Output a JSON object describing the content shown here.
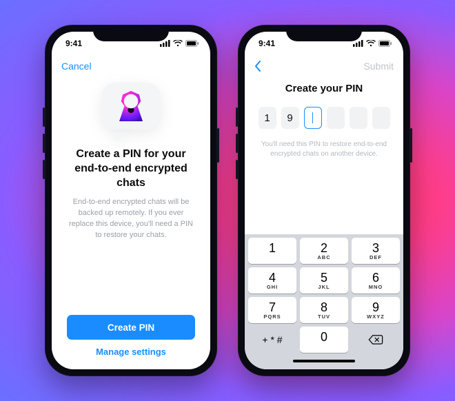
{
  "status": {
    "time": "9:41"
  },
  "screen1": {
    "nav": {
      "cancel": "Cancel"
    },
    "title": "Create a PIN for your end-to-end encrypted chats",
    "description": "End-to-end encrypted chats will be backed up remotely. If you ever replace this device, you'll need a PIN to restore your chats.",
    "primary": "Create PIN",
    "secondary": "Manage settings"
  },
  "screen2": {
    "nav": {
      "submit": "Submit"
    },
    "title": "Create your PIN",
    "pin": [
      "1",
      "9",
      "",
      "",
      "",
      ""
    ],
    "active_index": 2,
    "hint": "You'll need this PIN to restore end-to-end encrypted chats on another device.",
    "keypad": {
      "keys": [
        {
          "num": "1",
          "letters": ""
        },
        {
          "num": "2",
          "letters": "ABC"
        },
        {
          "num": "3",
          "letters": "DEF"
        },
        {
          "num": "4",
          "letters": "GHI"
        },
        {
          "num": "5",
          "letters": "JKL"
        },
        {
          "num": "6",
          "letters": "MNO"
        },
        {
          "num": "7",
          "letters": "PQRS"
        },
        {
          "num": "8",
          "letters": "TUV"
        },
        {
          "num": "9",
          "letters": "WXYZ"
        }
      ],
      "sym": "+ * #",
      "zero": "0"
    }
  }
}
